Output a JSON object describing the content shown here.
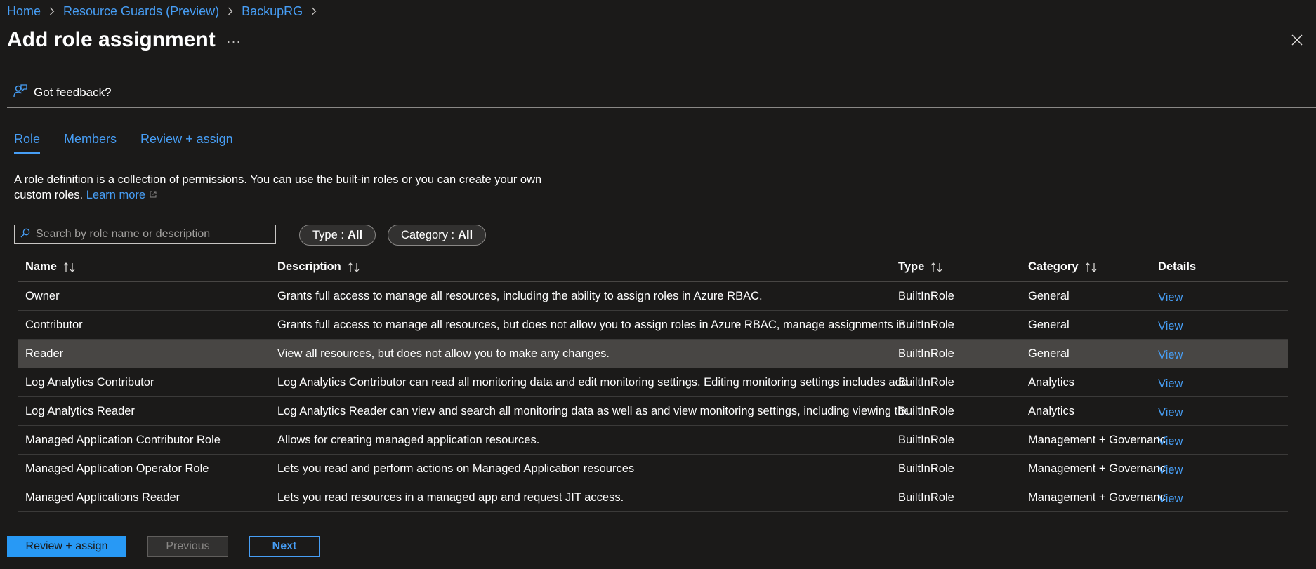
{
  "breadcrumb": [
    "Home",
    "Resource Guards (Preview)",
    "BackupRG"
  ],
  "title": "Add role assignment",
  "more_label": "···",
  "feedback_label": "Got feedback?",
  "tabs": [
    {
      "label": "Role",
      "active": true
    },
    {
      "label": "Members",
      "active": false
    },
    {
      "label": "Review + assign",
      "active": false
    }
  ],
  "intro": {
    "text": "A role definition is a collection of permissions. You can use the built-in roles or you can create your own custom roles.",
    "link": "Learn more"
  },
  "search": {
    "placeholder": "Search by role name or description",
    "value": ""
  },
  "filters": [
    {
      "label": "Type :",
      "value": "All"
    },
    {
      "label": "Category :",
      "value": "All"
    }
  ],
  "table": {
    "columns": [
      "Name",
      "Description",
      "Type",
      "Category",
      "Details"
    ],
    "rows": [
      {
        "name": "Owner",
        "description": "Grants full access to manage all resources, including the ability to assign roles in Azure RBAC.",
        "type": "BuiltInRole",
        "category": "General",
        "details": "View",
        "selected": false
      },
      {
        "name": "Contributor",
        "description": "Grants full access to manage all resources, but does not allow you to assign roles in Azure RBAC, manage assignments in Azure Blueprints, or share image galleries.",
        "type": "BuiltInRole",
        "category": "General",
        "details": "View",
        "selected": false
      },
      {
        "name": "Reader",
        "description": "View all resources, but does not allow you to make any changes.",
        "type": "BuiltInRole",
        "category": "General",
        "details": "View",
        "selected": true
      },
      {
        "name": "Log Analytics Contributor",
        "description": "Log Analytics Contributor can read all monitoring data and edit monitoring settings. Editing monitoring settings includes adding the VM extension to VMs.",
        "type": "BuiltInRole",
        "category": "Analytics",
        "details": "View",
        "selected": false
      },
      {
        "name": "Log Analytics Reader",
        "description": "Log Analytics Reader can view and search all monitoring data as well as and view monitoring settings, including viewing the configuration of Azure diagnostics.",
        "type": "BuiltInRole",
        "category": "Analytics",
        "details": "View",
        "selected": false
      },
      {
        "name": "Managed Application Contributor Role",
        "description": "Allows for creating managed application resources.",
        "type": "BuiltInRole",
        "category": "Management + Governance",
        "details": "View",
        "selected": false
      },
      {
        "name": "Managed Application Operator Role",
        "description": "Lets you read and perform actions on Managed Application resources",
        "type": "BuiltInRole",
        "category": "Management + Governance",
        "details": "View",
        "selected": false
      },
      {
        "name": "Managed Applications Reader",
        "description": "Lets you read resources in a managed app and request JIT access.",
        "type": "BuiltInRole",
        "category": "Management + Governance",
        "details": "View",
        "selected": false
      }
    ]
  },
  "buttons": {
    "review_assign": "Review + assign",
    "previous": "Previous",
    "next": "Next"
  },
  "colors": {
    "background": "#1b1a19",
    "accent": "#479ef5",
    "primary_button": "#2899f5",
    "selected_row": "#484644"
  }
}
